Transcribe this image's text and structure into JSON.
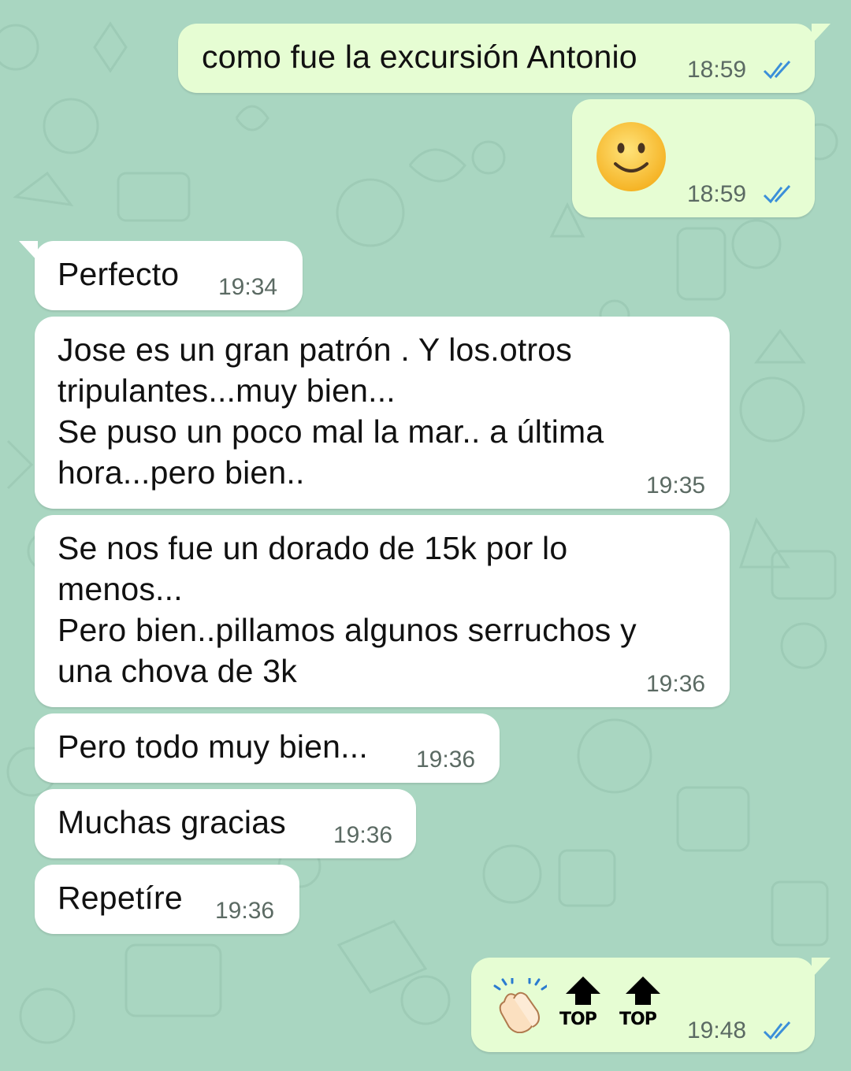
{
  "chat": {
    "messages": [
      {
        "direction": "outgoing",
        "text": "como fue la excursión Antonio",
        "time": "18:59",
        "status": "read"
      },
      {
        "direction": "outgoing",
        "emoji": "slightly-smiling-face-emoji",
        "time": "18:59",
        "status": "read"
      },
      {
        "direction": "incoming",
        "text": "Perfecto",
        "time": "19:34"
      },
      {
        "direction": "incoming",
        "text": "Jose es un gran patrón . Y los.otros\ntripulantes...muy bien...\nSe puso un poco mal la mar.. a última\nhora...pero bien..",
        "time": "19:35"
      },
      {
        "direction": "incoming",
        "text": "Se nos fue un dorado de 15k por lo\nmenos...\nPero bien..pillamos algunos serruchos y\nuna chova de 3k",
        "time": "19:36"
      },
      {
        "direction": "incoming",
        "text": "Pero todo muy bien...",
        "time": "19:36"
      },
      {
        "direction": "incoming",
        "text": "Muchas gracias",
        "time": "19:36"
      },
      {
        "direction": "incoming",
        "text": "Repetíre",
        "time": "19:36"
      },
      {
        "direction": "outgoing",
        "emojis": [
          "clapping-hands-emoji",
          "top-arrow-emoji",
          "top-arrow-emoji"
        ],
        "emoji_label": "TOP",
        "time": "19:48",
        "status": "read"
      }
    ]
  },
  "colors": {
    "wallpaper": "#a9d6c1",
    "outgoing_bubble": "#e6fdd3",
    "incoming_bubble": "#ffffff",
    "read_ticks": "#3b8fd9"
  }
}
